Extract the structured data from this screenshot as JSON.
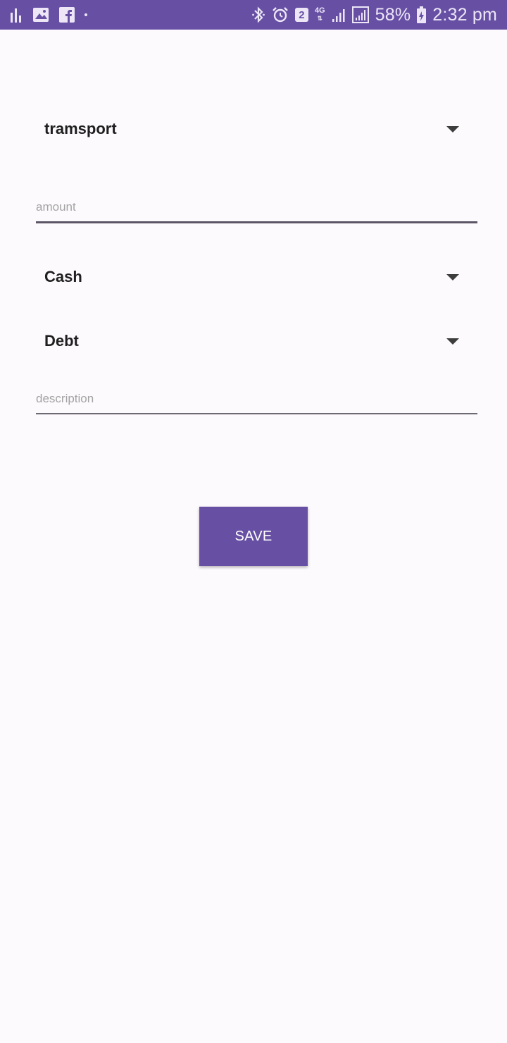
{
  "status_bar": {
    "battery_percent": "58%",
    "time": "2:32 pm",
    "notification_badge": "2",
    "network_type": "4G",
    "left_icons": [
      "bar-chart-icon",
      "image-icon",
      "facebook-icon",
      "dot-icon"
    ],
    "right_icons": [
      "bluetooth-icon",
      "alarm-icon",
      "sim-badge-icon",
      "network-4g-icon",
      "signal-icon",
      "signal-icon",
      "battery-charging-icon"
    ],
    "background_color": "#6750a4"
  },
  "form": {
    "category_spinner": {
      "selected": "tramsport"
    },
    "amount_field": {
      "placeholder": "amount",
      "value": ""
    },
    "account_spinner": {
      "selected": "Cash"
    },
    "type_spinner": {
      "selected": "Debt"
    },
    "description_field": {
      "placeholder": "description",
      "value": ""
    },
    "save_label": "SAVE",
    "accent_color": "#6750a4"
  }
}
